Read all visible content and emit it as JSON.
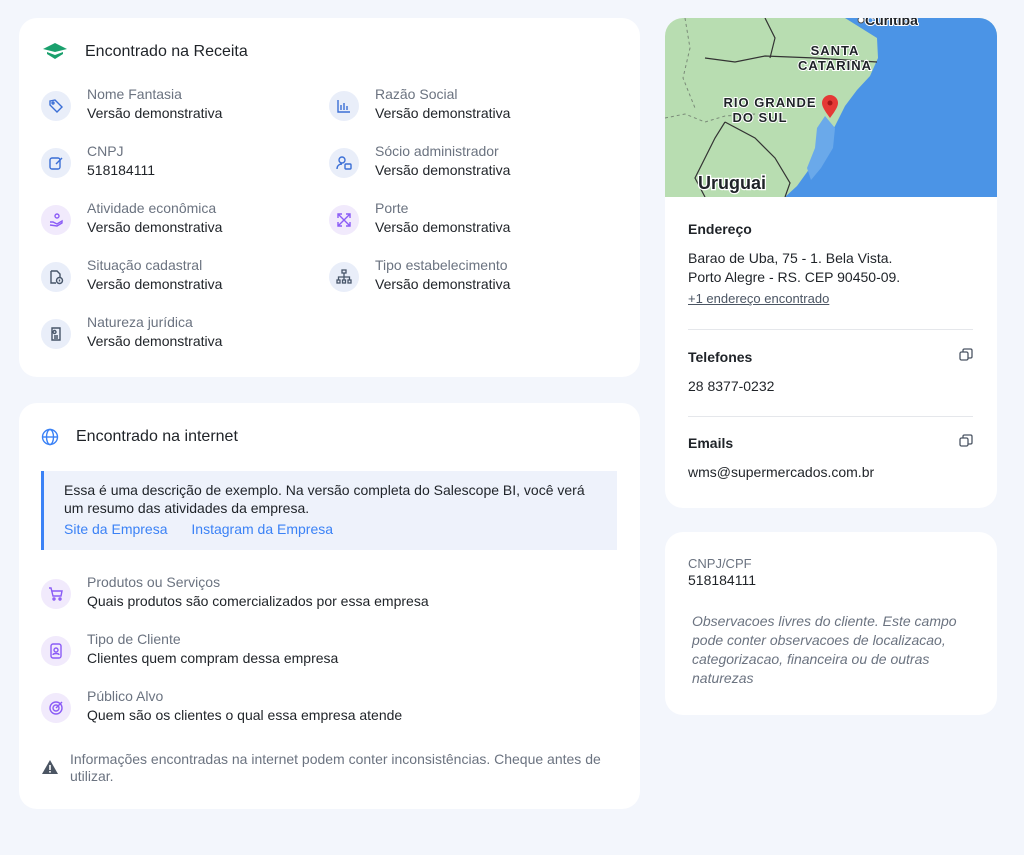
{
  "receita": {
    "title": "Encontrado na Receita",
    "fields": {
      "nome_fantasia": {
        "label": "Nome Fantasia",
        "value": "Versão demonstrativa",
        "icon": "tag-icon"
      },
      "razao_social": {
        "label": "Razão Social",
        "value": "Versão demonstrativa",
        "icon": "chart-icon"
      },
      "cnpj": {
        "label": "CNPJ",
        "value": "518184111",
        "icon": "edit-icon"
      },
      "socio": {
        "label": "Sócio administrador",
        "value": "Versão demonstrativa",
        "icon": "user-badge-icon"
      },
      "atividade": {
        "label": "Atividade econômica",
        "value": "Versão demonstrativa",
        "icon": "hand-coin-icon"
      },
      "porte": {
        "label": "Porte",
        "value": "Versão demonstrativa",
        "icon": "expand-arrows-icon"
      },
      "situacao": {
        "label": "Situação cadastral",
        "value": "Versão demonstrativa",
        "icon": "document-info-icon"
      },
      "tipo_estab": {
        "label": "Tipo estabelecimento",
        "value": "Versão demonstrativa",
        "icon": "hierarchy-icon"
      },
      "natureza": {
        "label": "Natureza jurídica",
        "value": "Versão demonstrativa",
        "icon": "legal-document-icon"
      }
    }
  },
  "internet": {
    "title": "Encontrado na internet",
    "description": "Essa é uma descrição de exemplo. Na versão completa do Salescope BI, você verá um resumo das atividades da empresa.",
    "link_site": "Site da Empresa",
    "link_instagram": "Instagram da Empresa",
    "items": {
      "produtos": {
        "label": "Produtos ou Serviços",
        "value": "Quais produtos são comercializados por essa empresa",
        "icon": "cart-icon"
      },
      "tipo_cliente": {
        "label": "Tipo de Cliente",
        "value": "Clientes quem compram dessa empresa",
        "icon": "person-card-icon"
      },
      "publico": {
        "label": "Público Alvo",
        "value": "Quem são os clientes o qual essa empresa atende",
        "icon": "target-icon"
      }
    },
    "warning": "Informações encontradas na internet podem conter inconsistências. Cheque antes de utilizar."
  },
  "map": {
    "labels": {
      "curitiba": "Curitiba",
      "santa_1": "SANTA",
      "santa_2": "CATARINA",
      "rio_1": "RIO GRANDE",
      "rio_2": "DO SUL",
      "uruguai": "Uruguai"
    }
  },
  "contact": {
    "address_title": "Endereço",
    "address_line1": "Barao de Uba, 75  - 1. Bela Vista.",
    "address_line2": "Porto Alegre - RS. CEP 90450-09.",
    "address_more": "+1 endereço encontrado",
    "phones_title": "Telefones",
    "phone": "28 8377-0232",
    "emails_title": "Emails",
    "email": "wms@supermercados.com.br"
  },
  "notes": {
    "label": "CNPJ/CPF",
    "value": "518184111",
    "observation": "Observacoes livres do cliente. Este campo pode conter observacoes de localizacao, categorizacao, financeira ou de outras naturezas"
  },
  "colors": {
    "accent": "#3b82f6",
    "brand_green": "#1aa06d",
    "pin_red": "#e53935",
    "background": "#f3f6fc"
  }
}
